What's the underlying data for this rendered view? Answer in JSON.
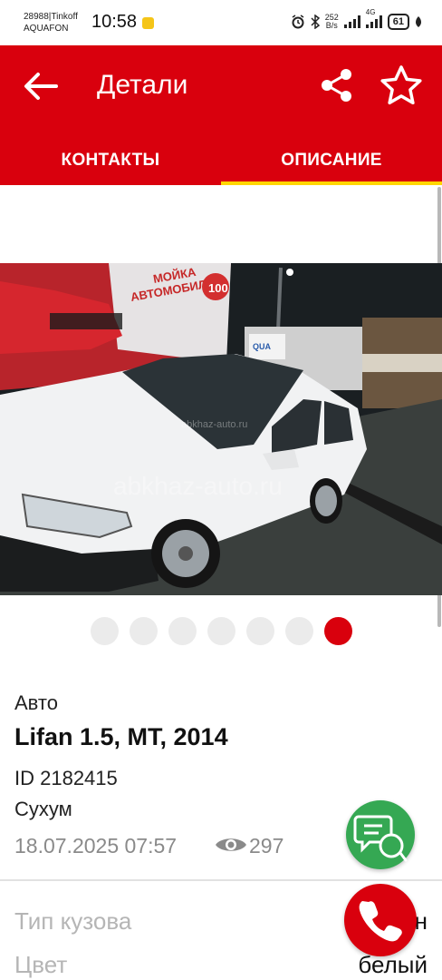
{
  "status_bar": {
    "carrier_line1": "28988|Tinkoff",
    "carrier_line2": "AQUAFON",
    "time": "10:58",
    "speed_value": "252",
    "speed_unit": "B/s",
    "network": "4G",
    "battery": "61"
  },
  "app_bar": {
    "title": "Детали",
    "tabs": [
      {
        "label": "КОНТАКТЫ"
      },
      {
        "label": "ОПИСАНИЕ"
      }
    ],
    "active_tab": 1
  },
  "gallery": {
    "watermark": "abkhaz-auto.ru",
    "watermark_small": "abkhaz-auto.ru",
    "sign_text": "МОЙКА АВТОМОБИЛЯ",
    "sign_price": "100",
    "photo_count": 7,
    "active_photo": 7
  },
  "listing": {
    "category": "Авто",
    "title": "Lifan 1.5, MT, 2014",
    "id": "ID 2182415",
    "city": "Сухум",
    "date": "18.07.2025 07:57",
    "views": "297"
  },
  "properties": [
    {
      "label": "Тип кузова",
      "value": "н"
    },
    {
      "label": "Цвет",
      "value": "белый"
    }
  ],
  "colors": {
    "accent": "#d9000d",
    "tab_indicator": "#ffd600",
    "chat_button": "#35a853"
  }
}
